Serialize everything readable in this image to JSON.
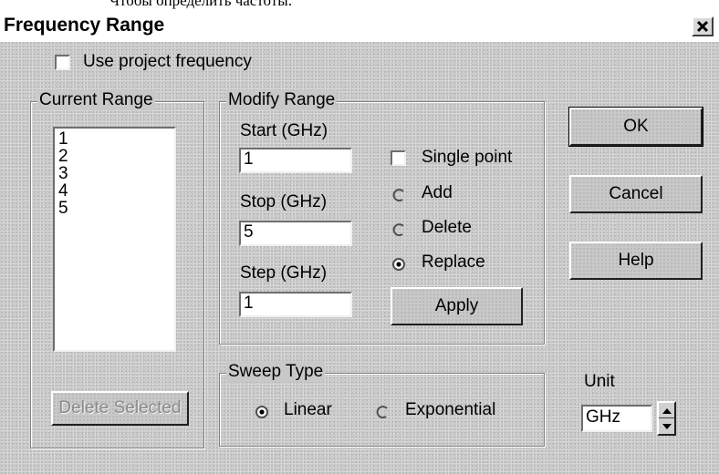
{
  "document": {
    "text_line": "Чтобы определить частоты:"
  },
  "dialog": {
    "title": "Frequency Range",
    "close_icon": "close-icon"
  },
  "use_project_frequency": {
    "label": "Use project frequency",
    "checked": false
  },
  "current_range": {
    "legend": "Current Range",
    "items": [
      "1",
      "2",
      "3",
      "4",
      "5"
    ],
    "delete_selected_label": "Delete Selected"
  },
  "modify_range": {
    "legend": "Modify Range",
    "start_label": "Start (GHz)",
    "start_value": "1",
    "stop_label": "Stop (GHz)",
    "stop_value": "5",
    "step_label": "Step (GHz)",
    "step_value": "1",
    "single_point_label": "Single point",
    "single_point_checked": false,
    "add_label": "Add",
    "delete_label": "Delete",
    "replace_label": "Replace",
    "selected_mode": "Replace",
    "apply_label": "Apply"
  },
  "buttons": {
    "ok": "OK",
    "cancel": "Cancel",
    "help": "Help"
  },
  "sweep_type": {
    "legend": "Sweep Type",
    "linear_label": "Linear",
    "exponential_label": "Exponential",
    "selected": "Linear"
  },
  "unit": {
    "label": "Unit",
    "value": "GHz"
  },
  "colors": {
    "dialog_face": "#c8c8c8",
    "shadow": "#808080",
    "highlight": "#ffffff",
    "disabled_text": "#8a8a8a"
  }
}
